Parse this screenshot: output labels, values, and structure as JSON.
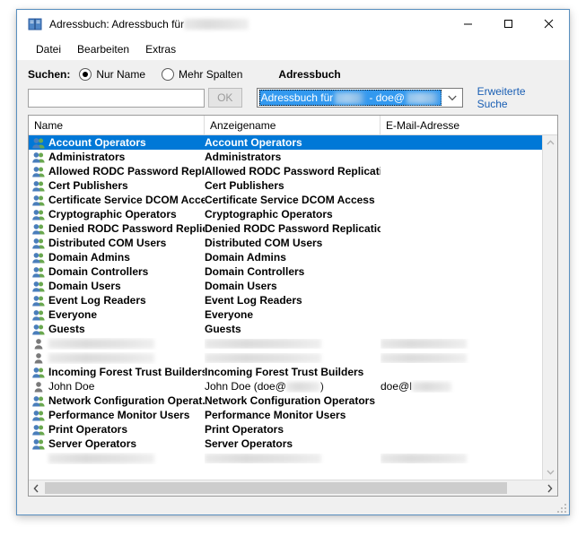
{
  "window": {
    "title_prefix": "Adressbuch: Adressbuch für ",
    "title_redacted": "",
    "app_icon": "address-book-icon",
    "minimize": "—",
    "maximize": "□",
    "close": "✕"
  },
  "menu": {
    "items": [
      {
        "label": "Datei"
      },
      {
        "label": "Bearbeiten"
      },
      {
        "label": "Extras"
      }
    ]
  },
  "search": {
    "label": "Suchen:",
    "radios": [
      {
        "label": "Nur Name",
        "checked": true
      },
      {
        "label": "Mehr Spalten",
        "checked": false
      }
    ],
    "book_label": "Adressbuch",
    "input_value": "",
    "input_placeholder": "",
    "ok_label": "OK",
    "combo_text_before": "Adressbuch für",
    "combo_text_middle": "- doe@",
    "combo_arrow": "chevron-down-icon",
    "advanced_link": "Erweiterte Suche"
  },
  "list": {
    "columns": [
      "Name",
      "Anzeigename",
      "E-Mail-Adresse"
    ],
    "rows": [
      {
        "name": "Account Operators",
        "display": "Account Operators",
        "email": "",
        "icon": "group",
        "selected": true,
        "bold": true,
        "redacted": false
      },
      {
        "name": "Administrators",
        "display": "Administrators",
        "email": "",
        "icon": "group",
        "selected": false,
        "bold": true,
        "redacted": false
      },
      {
        "name": "Allowed RODC Password Repli...",
        "display": "Allowed RODC Password Replicati...",
        "email": "",
        "icon": "group",
        "selected": false,
        "bold": true,
        "redacted": false
      },
      {
        "name": "Cert Publishers",
        "display": "Cert Publishers",
        "email": "",
        "icon": "group",
        "selected": false,
        "bold": true,
        "redacted": false
      },
      {
        "name": "Certificate Service DCOM Access",
        "display": "Certificate Service DCOM Access",
        "email": "",
        "icon": "group",
        "selected": false,
        "bold": true,
        "redacted": false
      },
      {
        "name": "Cryptographic Operators",
        "display": "Cryptographic Operators",
        "email": "",
        "icon": "group",
        "selected": false,
        "bold": true,
        "redacted": false
      },
      {
        "name": "Denied RODC Password Replic...",
        "display": "Denied RODC Password Replicatio...",
        "email": "",
        "icon": "group",
        "selected": false,
        "bold": true,
        "redacted": false
      },
      {
        "name": "Distributed COM Users",
        "display": "Distributed COM Users",
        "email": "",
        "icon": "group",
        "selected": false,
        "bold": true,
        "redacted": false
      },
      {
        "name": "Domain Admins",
        "display": "Domain Admins",
        "email": "",
        "icon": "group",
        "selected": false,
        "bold": true,
        "redacted": false
      },
      {
        "name": "Domain Controllers",
        "display": "Domain Controllers",
        "email": "",
        "icon": "group",
        "selected": false,
        "bold": true,
        "redacted": false
      },
      {
        "name": "Domain Users",
        "display": "Domain Users",
        "email": "",
        "icon": "group",
        "selected": false,
        "bold": true,
        "redacted": false
      },
      {
        "name": "Event Log Readers",
        "display": "Event Log Readers",
        "email": "",
        "icon": "group",
        "selected": false,
        "bold": true,
        "redacted": false
      },
      {
        "name": "Everyone",
        "display": "Everyone",
        "email": "",
        "icon": "group",
        "selected": false,
        "bold": true,
        "redacted": false
      },
      {
        "name": "Guests",
        "display": "Guests",
        "email": "",
        "icon": "group",
        "selected": false,
        "bold": true,
        "redacted": false
      },
      {
        "name": "",
        "display": "",
        "email": "",
        "icon": "user",
        "selected": false,
        "bold": false,
        "redacted": true
      },
      {
        "name": "",
        "display": "",
        "email": "",
        "icon": "user",
        "selected": false,
        "bold": false,
        "redacted": true
      },
      {
        "name": "Incoming Forest Trust Builders",
        "display": "Incoming Forest Trust Builders",
        "email": "",
        "icon": "group",
        "selected": false,
        "bold": true,
        "redacted": false
      },
      {
        "name": "John Doe",
        "display": "John Doe (doe@",
        "email": "doe@l",
        "icon": "user",
        "selected": false,
        "bold": false,
        "redacted": false,
        "display_suffix": ")"
      },
      {
        "name": "Network Configuration Operat...",
        "display": "Network Configuration Operators",
        "email": "",
        "icon": "group",
        "selected": false,
        "bold": true,
        "redacted": false
      },
      {
        "name": "Performance Monitor Users",
        "display": "Performance Monitor Users",
        "email": "",
        "icon": "group",
        "selected": false,
        "bold": true,
        "redacted": false
      },
      {
        "name": "Print Operators",
        "display": "Print Operators",
        "email": "",
        "icon": "group",
        "selected": false,
        "bold": true,
        "redacted": false
      },
      {
        "name": "Server Operators",
        "display": "Server Operators",
        "email": "",
        "icon": "group",
        "selected": false,
        "bold": true,
        "redacted": false
      },
      {
        "name": "",
        "display": "",
        "email": "",
        "icon": "none",
        "selected": false,
        "bold": false,
        "redacted": true
      }
    ]
  },
  "scrollbars": {
    "v_up": "scroll-up-icon",
    "v_down": "scroll-down-icon",
    "h_left": "scroll-left-icon",
    "h_right": "scroll-right-icon"
  },
  "colors": {
    "accent": "#0078d7",
    "combo_highlight": "#3399ef",
    "link": "#1a5fb4",
    "window_border": "#5a90c0"
  }
}
